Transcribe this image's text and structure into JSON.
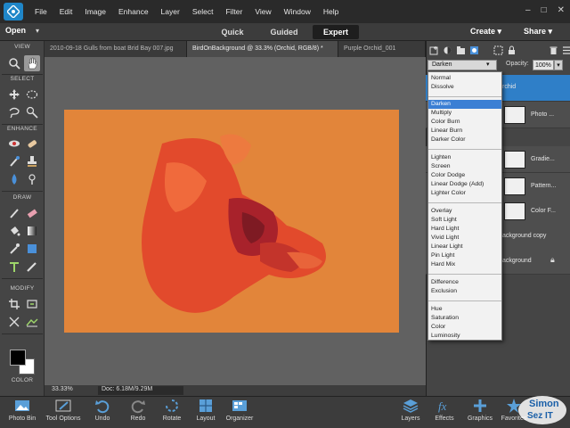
{
  "menu": [
    "File",
    "Edit",
    "Image",
    "Enhance",
    "Layer",
    "Select",
    "Filter",
    "View",
    "Window",
    "Help"
  ],
  "modebar": {
    "open_label": "Open",
    "quick": "Quick",
    "guided": "Guided",
    "expert": "Expert",
    "create": "Create",
    "share": "Share"
  },
  "toolbox": {
    "view": "VIEW",
    "select": "SELECT",
    "enhance": "ENHANCE",
    "draw": "DRAW",
    "modify": "MODIFY",
    "color": "COLOR"
  },
  "doc_tabs": [
    "2010-09-18 Gulls from boat Brid Bay 007.jpg",
    "BirdOnBackground @ 33.3% (Orchid, RGB/8) *",
    "Purple Orchid_001"
  ],
  "image_bg_color": "#e2853a",
  "status": {
    "zoom": "33.33%",
    "doc": "Doc: 6.18M/9.29M"
  },
  "layers_panel": {
    "blend_mode": "Darken",
    "opacity_label": "Opacity:",
    "opacity_value": "100%",
    "selected_layer_label": "rchid",
    "layer_rows": [
      "Photo ...",
      "Gradie...",
      "Pattern...",
      "Color F...",
      "ackground copy",
      "ackground"
    ]
  },
  "blend_modes": [
    [
      "Normal",
      "Dissolve"
    ],
    [
      "Darken",
      "Multiply",
      "Color Burn",
      "Linear Burn",
      "Darker Color"
    ],
    [
      "Lighten",
      "Screen",
      "Color Dodge",
      "Linear Dodge (Add)",
      "Lighter Color"
    ],
    [
      "Overlay",
      "Soft Light",
      "Hard Light",
      "Vivid Light",
      "Linear Light",
      "Pin Light",
      "Hard Mix"
    ],
    [
      "Difference",
      "Exclusion"
    ],
    [
      "Hue",
      "Saturation",
      "Color",
      "Luminosity"
    ]
  ],
  "bottom_bar": [
    "Photo Bin",
    "Tool Options",
    "Undo",
    "Redo",
    "Rotate",
    "Layout",
    "Organizer",
    "Layers",
    "Effects",
    "Graphics",
    "Favorites"
  ],
  "watermark": [
    "Simon",
    "Sez IT"
  ]
}
